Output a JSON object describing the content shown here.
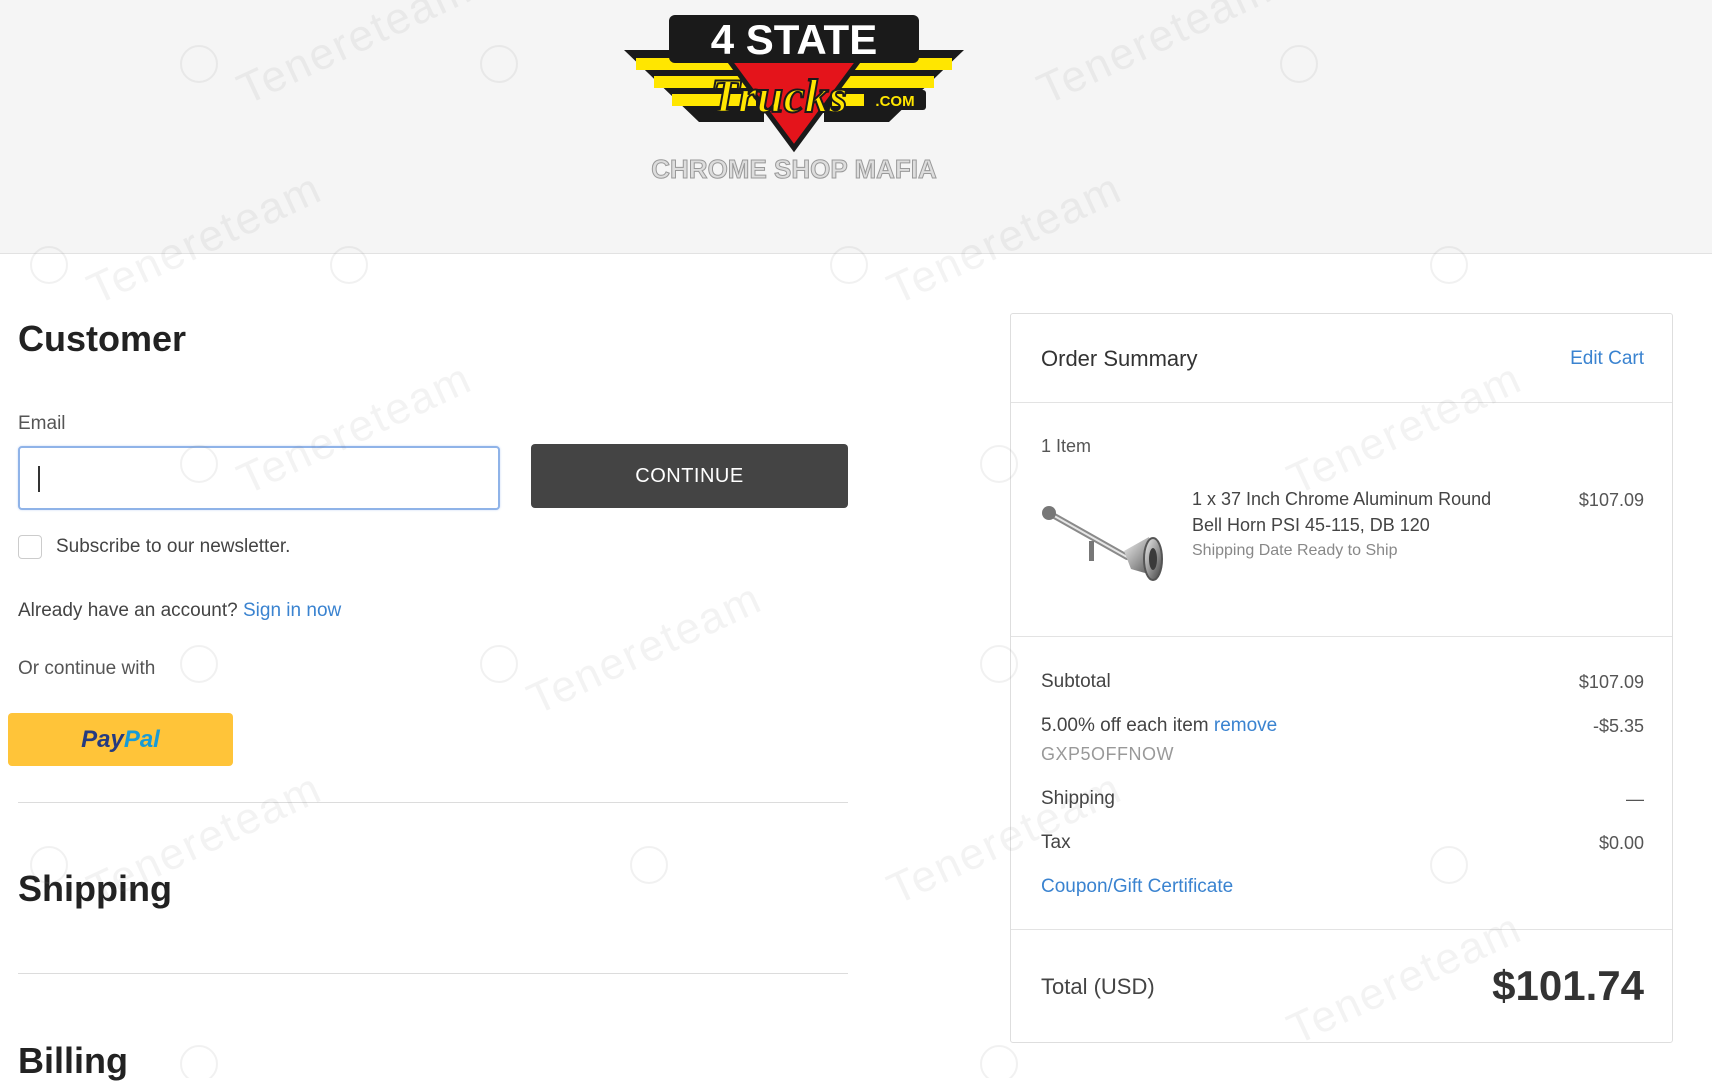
{
  "header": {
    "logo": {
      "brand_top": "4 STATE",
      "brand_script": "Trucks",
      "brand_suffix": ".COM",
      "tagline": "CHROME SHOP MAFIA"
    }
  },
  "customer": {
    "title": "Customer",
    "email_label": "Email",
    "email_value": "",
    "continue_label": "CONTINUE",
    "newsletter_label": "Subscribe to our newsletter.",
    "account_prompt": "Already have an account?",
    "sign_in_label": "Sign in now",
    "or_continue_label": "Or continue with",
    "paypal_part1": "Pay",
    "paypal_part2": "Pal"
  },
  "shipping": {
    "title": "Shipping"
  },
  "billing": {
    "title": "Billing"
  },
  "order_summary": {
    "title": "Order Summary",
    "edit_cart_label": "Edit Cart",
    "item_count": "1 Item",
    "item": {
      "name": "1 x 37 Inch Chrome Aluminum Round Bell Horn PSI 45-115, DB 120",
      "note": "Shipping Date Ready to Ship",
      "price": "$107.09"
    },
    "subtotal_label": "Subtotal",
    "subtotal_value": "$107.09",
    "discount_label": "5.00% off each item",
    "discount_remove_label": "remove",
    "discount_value": "-$5.35",
    "coupon_code": "GXP5OFFNOW",
    "shipping_label": "Shipping",
    "shipping_value": "—",
    "tax_label": "Tax",
    "tax_value": "$0.00",
    "coupon_link_label": "Coupon/Gift Certificate",
    "total_label": "Total (USD)",
    "total_value": "$101.74"
  },
  "watermark_text": "Tenereteam",
  "colors": {
    "link": "#3a83d0",
    "continue_button": "#444444",
    "paypal_button": "#ffc439",
    "logo_yellow": "#ffe600",
    "logo_red": "#e4141b"
  }
}
